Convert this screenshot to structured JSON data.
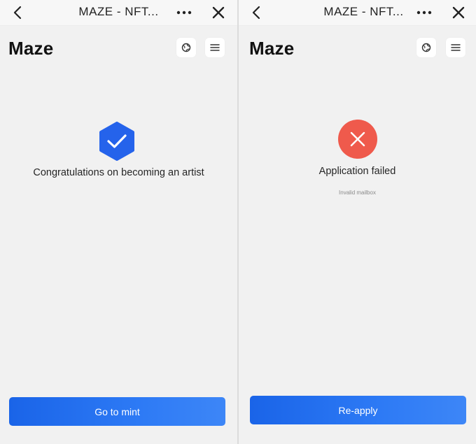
{
  "browser": {
    "title": "MAZE - NFT..."
  },
  "icons": {
    "back": "chevron-left-icon",
    "more": "more-horizontal-icon",
    "close": "close-icon",
    "language": "globe-icon",
    "menu": "hamburger-menu-icon",
    "success": "check-hexagon-icon",
    "failure": "x-circle-icon"
  },
  "app": {
    "logo": "Maze"
  },
  "left_screen": {
    "message": "Congratulations on becoming an artist",
    "button_label": "Go to mint"
  },
  "right_screen": {
    "message": "Application failed",
    "detail": "Invalid mailbox",
    "button_label": "Re-apply"
  },
  "colors": {
    "brand_blue": "#1a64e8",
    "success": "#2563eb",
    "failure": "#ef5a4c"
  }
}
